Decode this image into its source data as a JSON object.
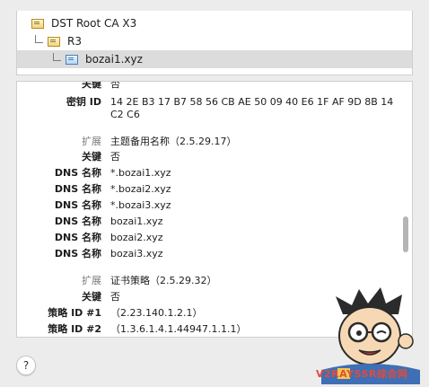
{
  "hierarchy": {
    "items": [
      {
        "label": "DST Root CA X3",
        "icon": "root-certificate-icon"
      },
      {
        "label": "R3",
        "icon": "intermediate-certificate-icon"
      },
      {
        "label": "bozai1.xyz",
        "icon": "leaf-certificate-icon",
        "selected": true
      }
    ]
  },
  "details": {
    "partial_critical": {
      "label": "关键",
      "value": "否"
    },
    "key_id": {
      "label": "密钥 ID",
      "value": "14 2E B3 17 B7 58 56 CB AE 50 09 40 E6 1F AF 9D 8B 14 C2 C6"
    },
    "san": {
      "ext_label": "扩展",
      "ext_value": "主题备用名称（2.5.29.17）",
      "critical_label": "关键",
      "critical_value": "否",
      "dns_label": "DNS 名称",
      "dns": [
        "*.bozai1.xyz",
        "*.bozai2.xyz",
        "*.bozai3.xyz",
        "bozai1.xyz",
        "bozai2.xyz",
        "bozai3.xyz"
      ]
    },
    "policies": {
      "ext_label": "扩展",
      "ext_value": "证书策略（2.5.29.32）",
      "critical_label": "关键",
      "critical_value": "否",
      "policy1_label": "策略 ID #1",
      "policy1_value": "（2.23.140.1.2.1）",
      "policy2_label": "策略 ID #2",
      "policy2_value": "（1.3.6.1.4.1.44947.1.1.1）"
    }
  },
  "help": {
    "label": "?"
  },
  "watermark": {
    "text": "V2RAYSSR综合网"
  },
  "colors": {
    "selection": "#dcdcdc",
    "section_label": "#7a7a7a",
    "watermark": "#e24b3d"
  }
}
